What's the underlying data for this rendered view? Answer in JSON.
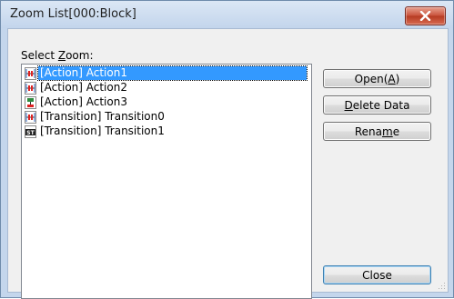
{
  "window": {
    "title": "Zoom List[000:Block]"
  },
  "select_label": {
    "pre": "Select ",
    "accel": "Z",
    "post": "oom:"
  },
  "list": [
    {
      "label": "[Action] Action1",
      "icon": "ladder-icon",
      "selected": true
    },
    {
      "label": "[Action] Action2",
      "icon": "ladder-icon",
      "selected": false
    },
    {
      "label": "[Action] Action3",
      "icon": "sfc-icon",
      "selected": false
    },
    {
      "label": "[Transition] Transition0",
      "icon": "ladder-icon",
      "selected": false
    },
    {
      "label": "[Transition] Transition1",
      "icon": "st-icon",
      "selected": false
    }
  ],
  "buttons": {
    "open": {
      "pre": "Open(",
      "accel": "A",
      "post": ")"
    },
    "delete": {
      "pre": "",
      "accel": "D",
      "post": "elete Data"
    },
    "rename": {
      "pre": "Rena",
      "accel": "m",
      "post": "e"
    },
    "close": {
      "label": "Close"
    }
  },
  "colors": {
    "selection": "#3399ff",
    "title_close": "#c8513a"
  }
}
